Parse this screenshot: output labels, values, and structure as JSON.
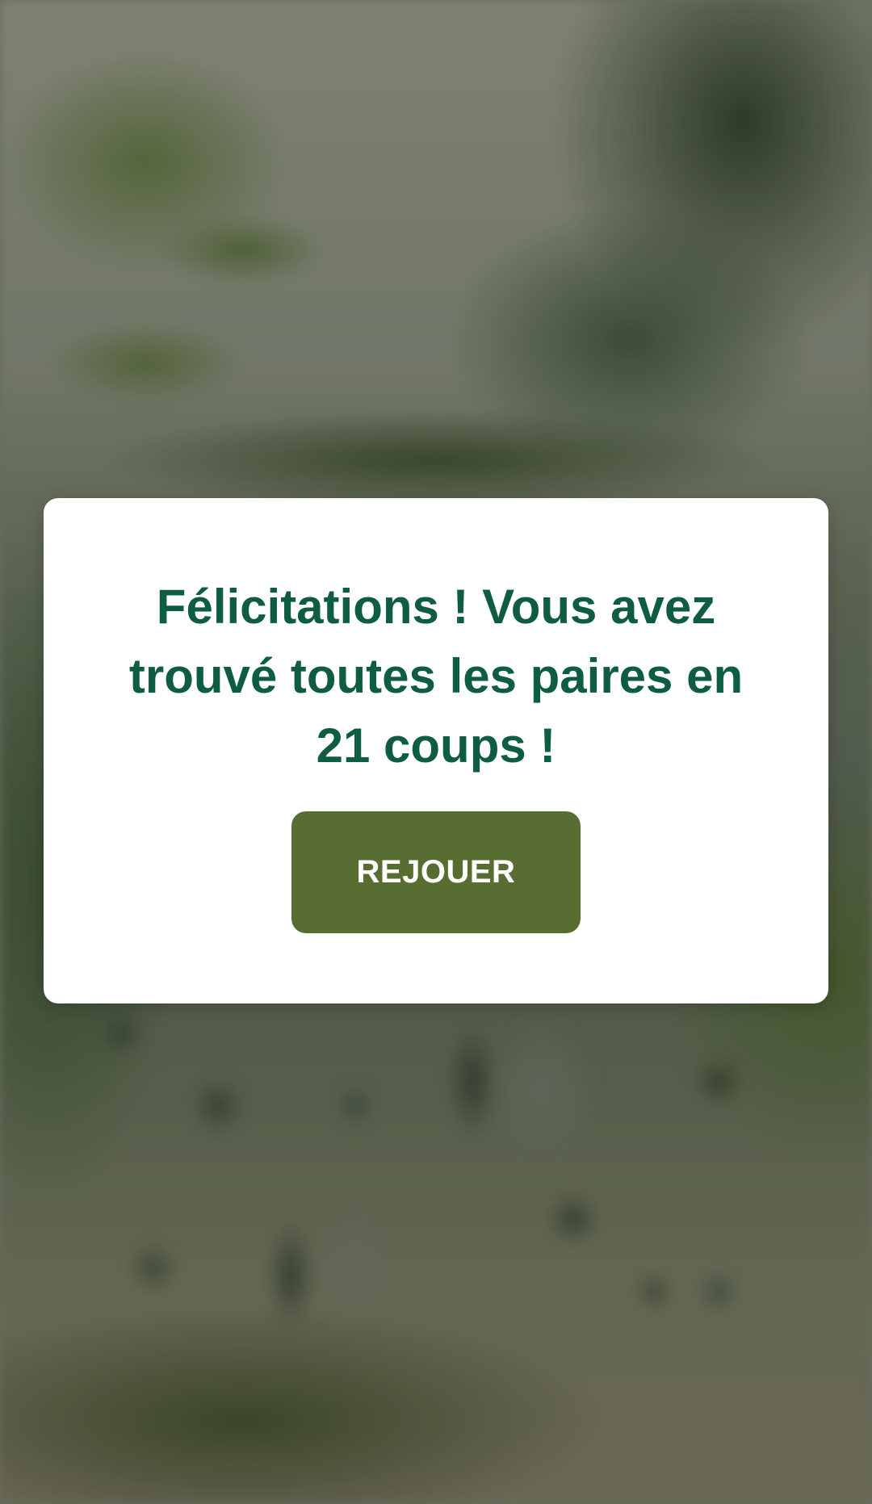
{
  "dialog": {
    "message": "Félicitations ! Vous avez trouvé toutes les paires en 21 coups !",
    "replay_label": "REJOUER"
  },
  "colors": {
    "message_text": "#0d5c43",
    "button_background": "#586d31",
    "button_text": "#ffffff",
    "dialog_background": "#ffffff"
  }
}
